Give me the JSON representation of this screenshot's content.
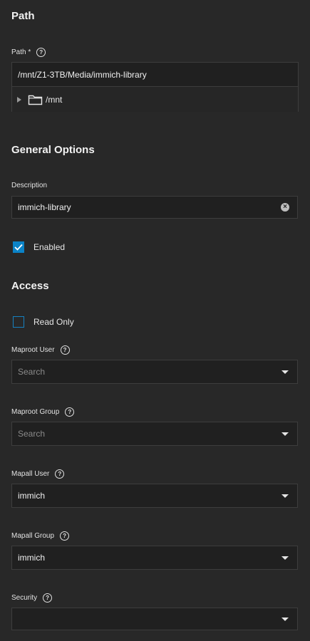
{
  "path_section": {
    "title": "Path",
    "path_label": "Path *",
    "path_value": "/mnt/Z1-3TB/Media/immich-library",
    "tree_node_label": "/mnt"
  },
  "general_section": {
    "title": "General Options",
    "description_label": "Description",
    "description_value": "immich-library",
    "enabled_label": "Enabled",
    "enabled_checked": true
  },
  "access_section": {
    "title": "Access",
    "read_only_label": "Read Only",
    "read_only_checked": false,
    "maproot_user_label": "Maproot User",
    "maproot_user_placeholder": "Search",
    "maproot_group_label": "Maproot Group",
    "maproot_group_placeholder": "Search",
    "mapall_user_label": "Mapall User",
    "mapall_user_value": "immich",
    "mapall_group_label": "Mapall Group",
    "mapall_group_value": "immich",
    "security_label": "Security",
    "security_value": ""
  },
  "icons": {
    "help": "question-circle-icon",
    "folder": "folder-icon",
    "expand": "triangle-right-icon",
    "clear": "clear-circle-icon",
    "dropdown": "caret-down-icon"
  },
  "colors": {
    "background": "#282828",
    "input_background": "#202020",
    "accent": "#0b83c7"
  }
}
